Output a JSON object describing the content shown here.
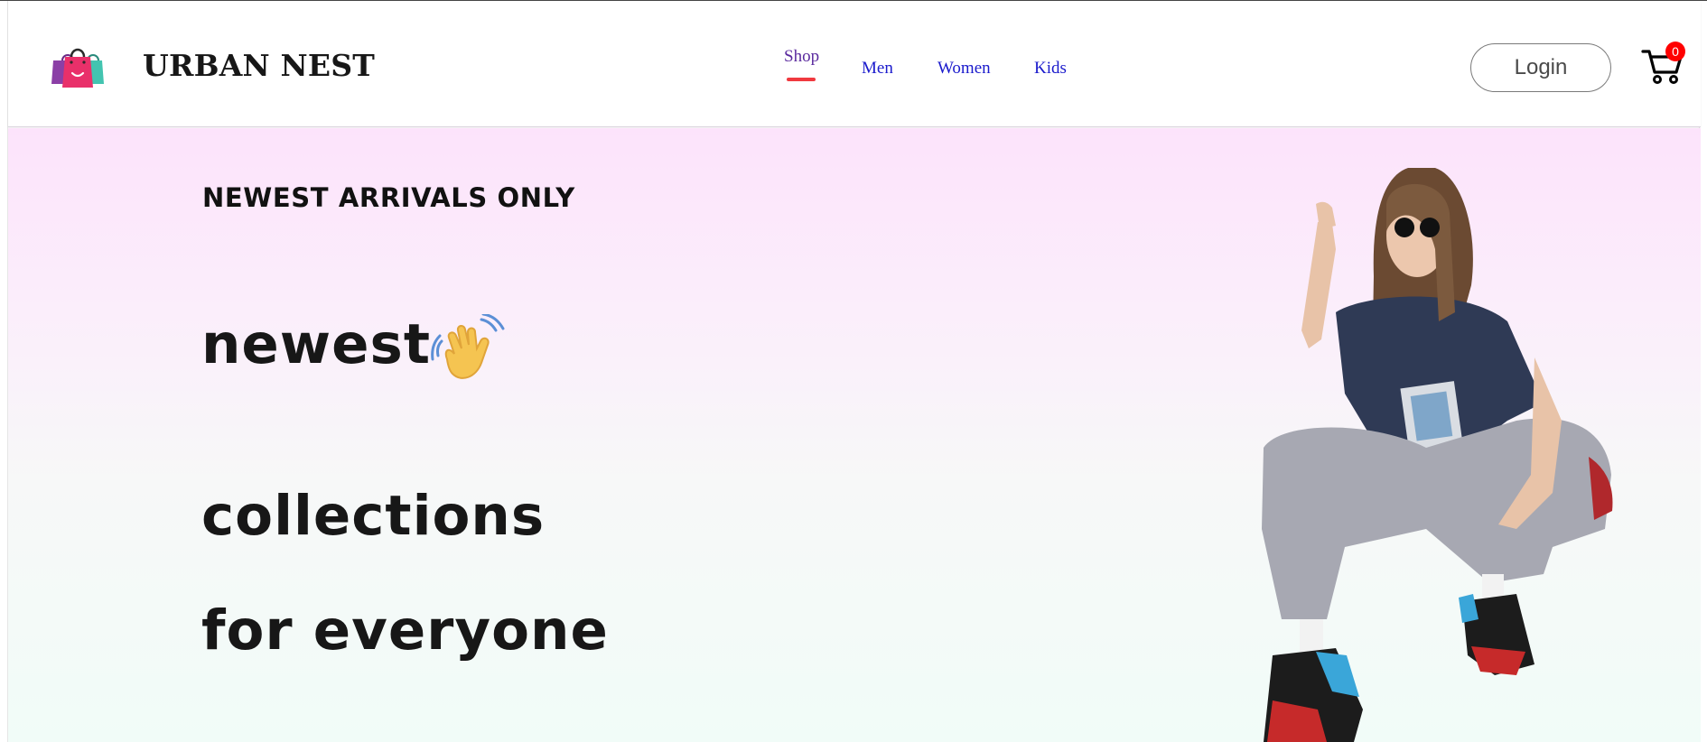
{
  "brand": {
    "name": "URBAN NEST",
    "logo_icon": "shopping-bags-icon"
  },
  "nav": {
    "items": [
      {
        "label": "Shop",
        "active": true
      },
      {
        "label": "Men",
        "active": false
      },
      {
        "label": "Women",
        "active": false
      },
      {
        "label": "Kids",
        "active": false
      }
    ],
    "active_indicator_color": "#f0393f",
    "link_color": "#1a1acc"
  },
  "header_actions": {
    "login_label": "Login",
    "cart_icon": "cart-icon",
    "cart_count": "0",
    "badge_color": "#ff0000"
  },
  "hero": {
    "eyebrow": "NEWEST ARRIVALS ONLY",
    "line1": "newest",
    "line1_icon": "waving-hand-icon",
    "line2": "collections",
    "line3": "for everyone",
    "image": "fashion-model-photo",
    "gradient_top": "#fce3fb",
    "gradient_bottom": "#f1fcf8"
  }
}
